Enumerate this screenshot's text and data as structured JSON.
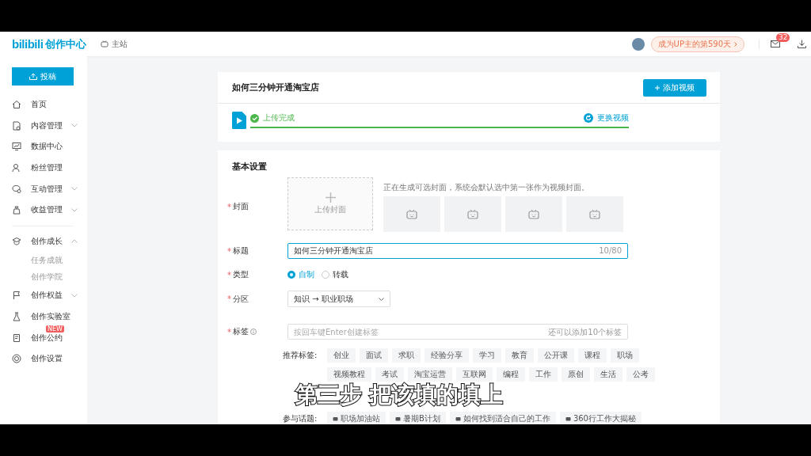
{
  "header": {
    "logo": "bilibili",
    "title": "创作中心",
    "home_link": "主站",
    "promo": "成为UP主的第590天",
    "mail_badge": "32"
  },
  "sidebar": {
    "upload_button": "投稿",
    "items": [
      {
        "label": "首页",
        "kind": "link"
      },
      {
        "label": "内容管理",
        "kind": "menu",
        "expanded": false
      },
      {
        "label": "数据中心",
        "kind": "link"
      },
      {
        "label": "粉丝管理",
        "kind": "link"
      },
      {
        "label": "互动管理",
        "kind": "menu",
        "expanded": false
      },
      {
        "label": "收益管理",
        "kind": "menu",
        "expanded": false
      },
      {
        "label": "创作成长",
        "kind": "menu",
        "expanded": true,
        "children": [
          {
            "label": "任务成就"
          },
          {
            "label": "创作学院"
          }
        ]
      },
      {
        "label": "创作权益",
        "kind": "menu",
        "expanded": false
      },
      {
        "label": "创作实验室",
        "kind": "link"
      },
      {
        "label": "创作公约",
        "kind": "link",
        "badge": "NEW"
      },
      {
        "label": "创作设置",
        "kind": "link"
      }
    ]
  },
  "upload_card": {
    "title": "如何三分钟开通淘宝店",
    "add_button": "添加视频",
    "status": "上传完成",
    "level": 1,
    "replace_link": "更换视频"
  },
  "form": {
    "section_title": "基本设置",
    "cover": {
      "mark": "*",
      "label": "封面",
      "upload": "上传封面",
      "hint": "正在生成可选封面，系统会默认选中第一张作为视频封面。",
      "thumbnails": [
        {
          "kind": "placeholder"
        },
        {
          "kind": "placeholder"
        },
        {
          "kind": "placeholder"
        },
        {
          "kind": "placeholder"
        }
      ]
    },
    "title": {
      "mark": "*",
      "label": "标题",
      "value": "如何三分钟开通淘宝店",
      "counter": "10/80"
    },
    "type": {
      "mark": "*",
      "label": "类型",
      "options": [
        {
          "label": "自制",
          "selected": true
        },
        {
          "label": "转载",
          "selected": false
        }
      ]
    },
    "zone": {
      "mark": "*",
      "label": "分区",
      "value": "知识 → 职业职场"
    },
    "tags": {
      "mark": "*",
      "label": "标签",
      "placeholder": "按回车键Enter创建标签",
      "remaining": "还可以添加10个标签"
    },
    "recommended_label": "推荐标签:",
    "recommended": [
      "创业",
      "面试",
      "求职",
      "经验分享",
      "学习",
      "教育",
      "公开课",
      "课程",
      "职场",
      "视频教程",
      "考试",
      "淘宝运营",
      "互联网",
      "编程",
      "工作",
      "原创",
      "生活",
      "公考"
    ],
    "topics_label": "参与话题:",
    "topics": [
      "职场加油站",
      "暑期B计划",
      "如何找到适合自己的工作",
      "360行工作大揭秘"
    ]
  },
  "subtitle": "第三步 把该填的填上"
}
